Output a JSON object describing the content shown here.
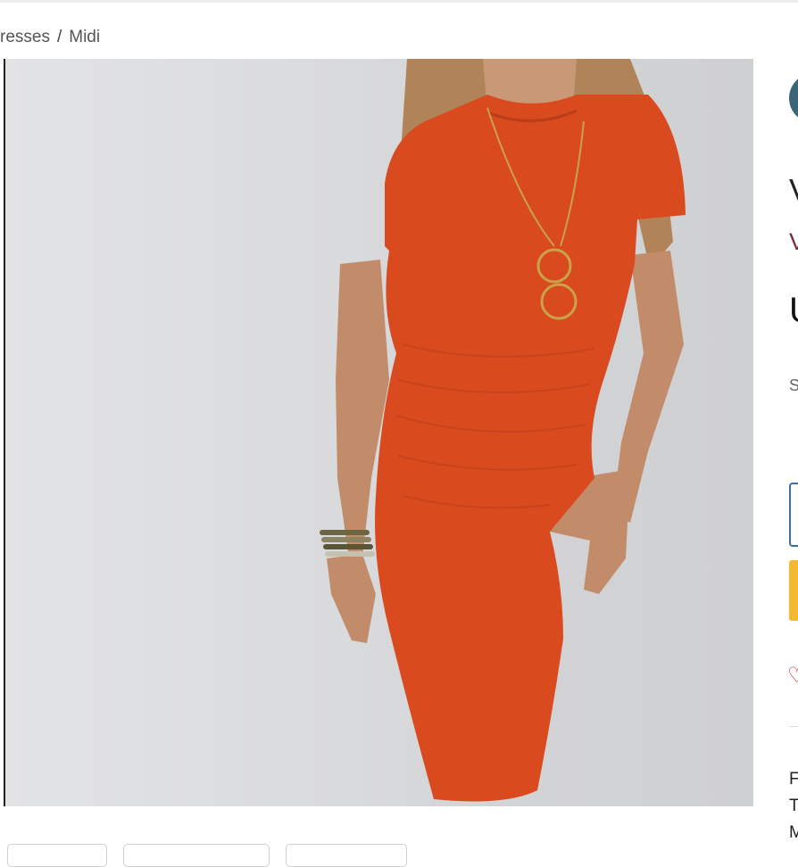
{
  "breadcrumb": {
    "items": [
      "resses",
      "Midi"
    ],
    "separator": "/"
  },
  "product": {
    "image_name": "orange-midi-dress-photo",
    "accent_color": "#d94a1e",
    "title_fragment": "V",
    "subtitle_fragment": "V",
    "price_fragment": "U",
    "size_label_fragment": "S",
    "description_fragments": [
      "F",
      "T",
      "M"
    ]
  },
  "buttons": {
    "select_color": "#3d6fa3",
    "add_to_cart_color": "#f2b830"
  },
  "icons": {
    "wishlist": "heart-icon",
    "brand": "brand-logo-circle"
  }
}
